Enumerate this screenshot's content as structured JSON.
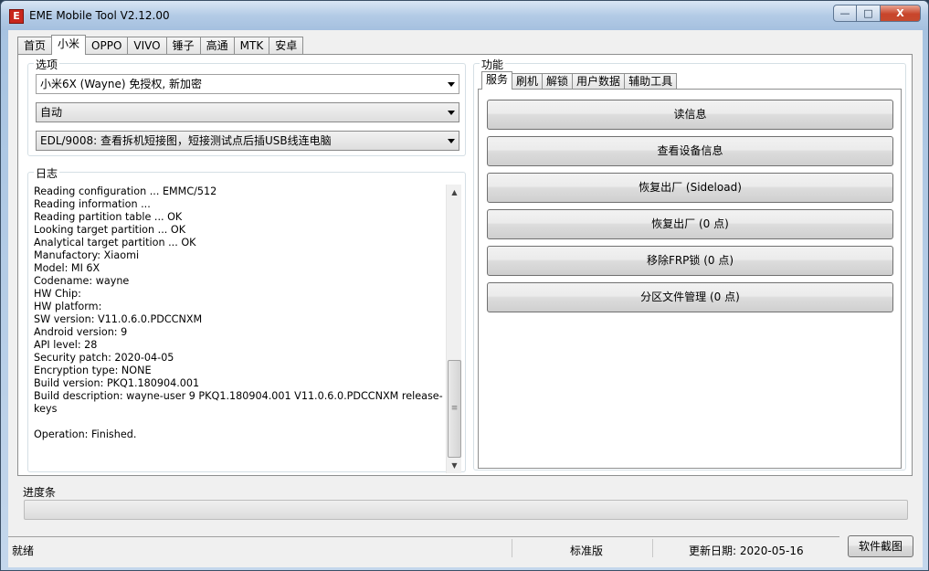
{
  "window": {
    "title": "EME Mobile Tool V2.12.00",
    "icon_text": "E",
    "buttons": {
      "minimize": "—",
      "maximize": "□",
      "close": "X"
    }
  },
  "main_tabs": [
    "首页",
    "小米",
    "OPPO",
    "VIVO",
    "锤子",
    "高通",
    "MTK",
    "安卓"
  ],
  "active_main_tab": "小米",
  "options": {
    "title": "选项",
    "model_select": "小米6X (Wayne) 免授权, 新加密",
    "mode_select": "自动",
    "edl_select": "EDL/9008: 查看拆机短接图，短接测试点后插USB线连电脑"
  },
  "log": {
    "title": "日志",
    "lines": [
      "Reading configuration ... EMMC/512",
      "Reading information ...",
      "Reading partition table ... OK",
      "Looking target partition ... OK",
      "Analytical target partition ... OK",
      "Manufactory: Xiaomi",
      "Model: MI 6X",
      "Codename: wayne",
      "HW Chip:",
      "HW platform:",
      "SW version: V11.0.6.0.PDCCNXM",
      "Android version: 9",
      "API level: 28",
      "Security patch: 2020-04-05",
      "Encryption type: NONE",
      "Build version: PKQ1.180904.001",
      "Build description: wayne-user 9 PKQ1.180904.001 V11.0.6.0.PDCCNXM release-",
      "keys",
      "",
      "Operation: Finished."
    ]
  },
  "functions": {
    "title": "功能",
    "tabs": [
      "服务",
      "刷机",
      "解锁",
      "用户数据",
      "辅助工具"
    ],
    "active_tab": "服务",
    "buttons": [
      "读信息",
      "查看设备信息",
      "恢复出厂 (Sideload)",
      "恢复出厂 (0 点)",
      "移除FRP锁 (0 点)",
      "分区文件管理 (0 点)"
    ]
  },
  "progress": {
    "label": "进度条",
    "value": 0
  },
  "status": {
    "state": "就绪",
    "edition": "标准版",
    "update_date": "更新日期: 2020-05-16",
    "screenshot_button": "软件截图"
  }
}
